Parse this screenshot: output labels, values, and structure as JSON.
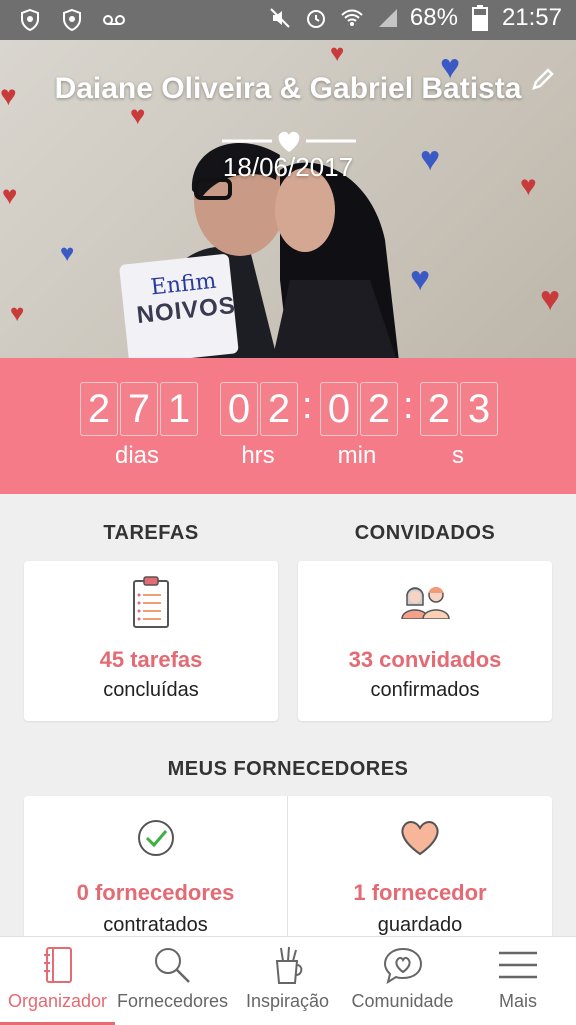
{
  "status_bar": {
    "battery": "68%",
    "time": "21:57",
    "left_icons": [
      "shield-icon",
      "shield-icon",
      "voicemail-icon"
    ],
    "right_icons": [
      "mute-icon",
      "alarm-icon",
      "wifi-icon",
      "signal-icon",
      "battery-icon"
    ]
  },
  "hero": {
    "title": "Daiane Oliveira & Gabriel Batista",
    "date": "18/06/2017",
    "sign_line1": "Enfim",
    "sign_line2": "NOIVOS"
  },
  "countdown": {
    "days": [
      "2",
      "7",
      "1"
    ],
    "hours": [
      "0",
      "2"
    ],
    "minutes": [
      "0",
      "2"
    ],
    "seconds": [
      "2",
      "3"
    ],
    "label_days": "dias",
    "label_hours": "hrs",
    "label_minutes": "min",
    "label_seconds": "s"
  },
  "tasks": {
    "title": "TAREFAS",
    "count": "45 tarefas",
    "status": "concluídas"
  },
  "guests": {
    "title": "CONVIDADOS",
    "count": "33 convidados",
    "status": "confirmados"
  },
  "vendors": {
    "title": "MEUS FORNECEDORES",
    "hired_count": "0 fornecedores",
    "hired_status": "contratados",
    "saved_count": "1 fornecedor",
    "saved_status": "guardado"
  },
  "nav": {
    "items": [
      {
        "label": "Organizador",
        "icon": "notebook-icon",
        "active": true
      },
      {
        "label": "Fornecedores",
        "icon": "search-icon"
      },
      {
        "label": "Inspiração",
        "icon": "pencil-cup-icon"
      },
      {
        "label": "Comunidade",
        "icon": "chat-heart-icon"
      },
      {
        "label": "Mais",
        "icon": "menu-icon"
      }
    ]
  },
  "colors": {
    "accent": "#f47b87",
    "text_accent": "#e46a73",
    "status_bar": "#6f6f6f"
  }
}
